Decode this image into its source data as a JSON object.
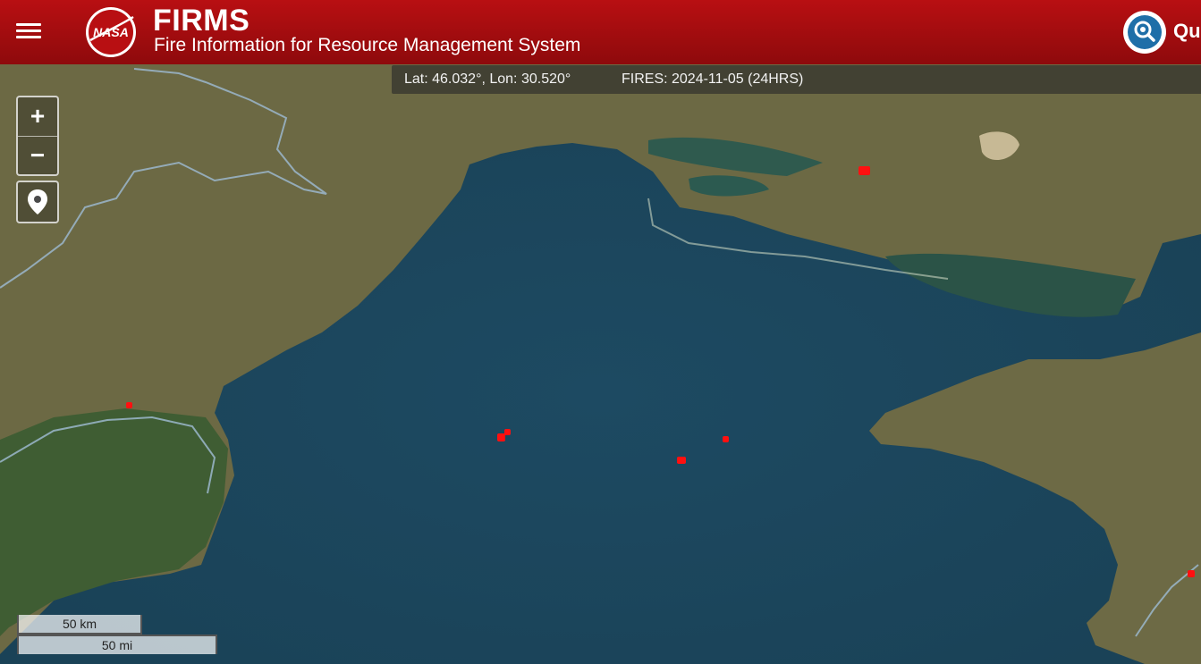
{
  "header": {
    "app_title": "FIRMS",
    "app_subtitle": "Fire Information for Resource Management System",
    "logo_text": "NASA",
    "quick_label": "Qui"
  },
  "info_bar": {
    "coordinates": "Lat: 46.032°, Lon: 30.520°",
    "fires": "FIRES: 2024-11-05 (24HRS)"
  },
  "controls": {
    "zoom_in": "+",
    "zoom_out": "−"
  },
  "scale": {
    "km": "50 km",
    "mi": "50 mi"
  },
  "icons": [
    "hamburger-menu-icon",
    "nasa-logo",
    "search-map-icon",
    "location-pin-icon"
  ],
  "colors": {
    "header": "#a50d10",
    "fire": "#ff1010",
    "sea": "#1f4b63",
    "land": "#6f6a45"
  }
}
